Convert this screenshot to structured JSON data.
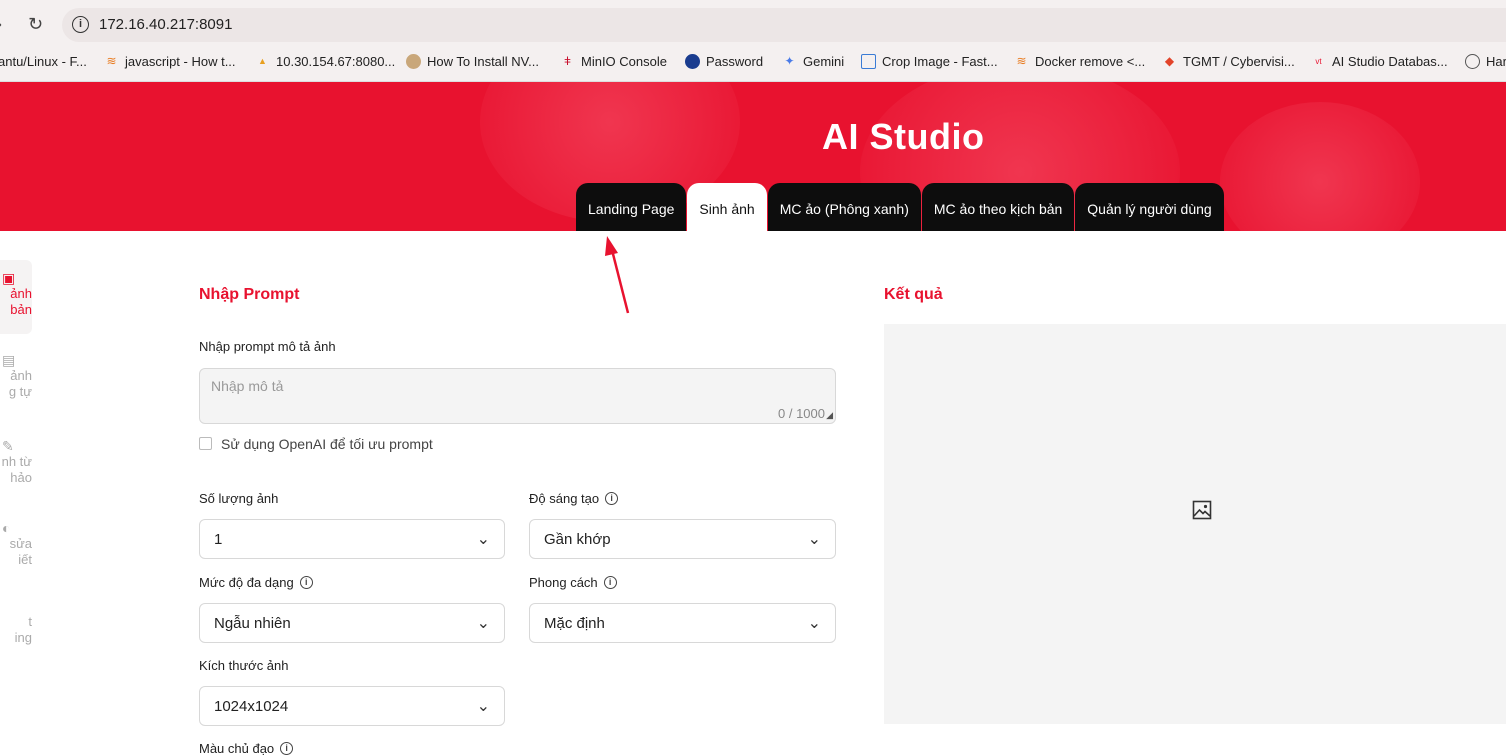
{
  "browser": {
    "url": "172.16.40.217:8091",
    "bookmarks": [
      {
        "label": "antu/Linux - F...",
        "icon": "bookmark-icon"
      },
      {
        "label": "javascript - How t...",
        "icon": "stackoverflow-icon"
      },
      {
        "label": "10.30.154.67:8080...",
        "icon": "pma-icon"
      },
      {
        "label": "How To Install NV...",
        "icon": "site-icon"
      },
      {
        "label": "MinIO Console",
        "icon": "minio-icon"
      },
      {
        "label": "Password",
        "icon": "password-icon"
      },
      {
        "label": "Gemini",
        "icon": "gemini-icon"
      },
      {
        "label": "Crop Image - Fast...",
        "icon": "crop-icon"
      },
      {
        "label": "Docker remove <...",
        "icon": "stackoverflow-icon"
      },
      {
        "label": "TGMT / Cybervisi...",
        "icon": "gitlab-icon"
      },
      {
        "label": "AI Studio Databas...",
        "icon": "viettel-icon"
      },
      {
        "label": "Har",
        "icon": "globe-icon"
      }
    ]
  },
  "header": {
    "title": "AI Studio",
    "tabs": [
      {
        "label": "Landing Page",
        "active": false
      },
      {
        "label": "Sinh ảnh",
        "active": true
      },
      {
        "label": "MC ảo (Phông xanh)",
        "active": false
      },
      {
        "label": "MC ảo theo kịch bản",
        "active": false
      },
      {
        "label": "Quản lý người dùng",
        "active": false
      }
    ]
  },
  "sidebar": {
    "items": [
      {
        "line1": "ảnh",
        "line2": "bản",
        "active": true
      },
      {
        "line1": "ảnh",
        "line2": "g tự",
        "active": false
      },
      {
        "line1": "nh từ",
        "line2": "hảo",
        "active": false
      },
      {
        "line1": "sửa",
        "line2": "iết",
        "active": false
      },
      {
        "line1": "t",
        "line2": "ing",
        "active": false
      }
    ]
  },
  "form": {
    "section_title": "Nhập Prompt",
    "prompt_label": "Nhập prompt mô tả ảnh",
    "prompt_placeholder": "Nhập mô tả",
    "prompt_counter": "0 / 1000",
    "openai_checkbox_label": "Sử dụng OpenAI để tối ưu prompt",
    "openai_checked": false,
    "quantity_label": "Số lượng ảnh",
    "quantity_value": "1",
    "creativity_label": "Độ sáng tạo",
    "creativity_value": "Gần khớp",
    "diversity_label": "Mức độ đa dạng",
    "diversity_value": "Ngẫu nhiên",
    "style_label": "Phong cách",
    "style_value": "Mặc định",
    "size_label": "Kích thước ảnh",
    "size_value": "1024x1024",
    "color_label": "Màu chủ đạo"
  },
  "result": {
    "section_title": "Kết quả"
  },
  "colors": {
    "brand_red": "#e8122f",
    "tab_dark": "#0d0d0d",
    "annotation_arrow": "#e8122f"
  }
}
